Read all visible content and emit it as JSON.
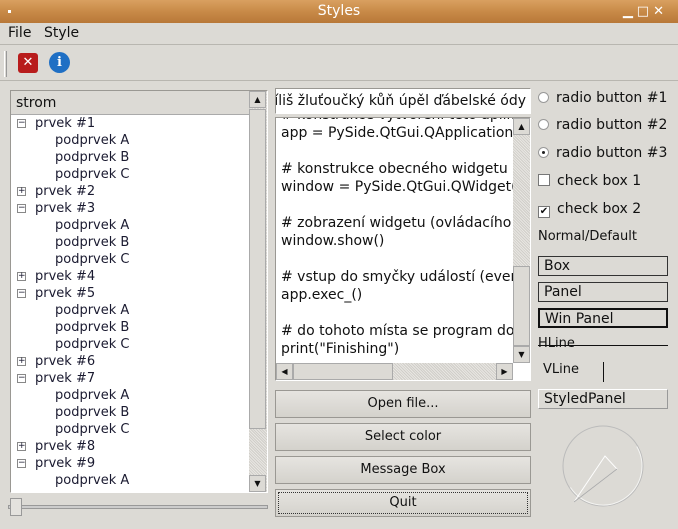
{
  "window": {
    "title": "Styles"
  },
  "menu": [
    "File",
    "Style"
  ],
  "toolbar": {
    "quit_icon": "close-icon",
    "about_icon": "info-icon"
  },
  "tree": {
    "header": "strom",
    "items": [
      {
        "label": "prvek #1",
        "expanded": true,
        "children": [
          "podprvek A",
          "podprvek B",
          "podprvek C"
        ]
      },
      {
        "label": "prvek #2",
        "expanded": false,
        "children": []
      },
      {
        "label": "prvek #3",
        "expanded": true,
        "children": [
          "podprvek A",
          "podprvek B",
          "podprvek C"
        ]
      },
      {
        "label": "prvek #4",
        "expanded": false,
        "children": []
      },
      {
        "label": "prvek #5",
        "expanded": true,
        "children": [
          "podprvek A",
          "podprvek B",
          "podprvek C"
        ]
      },
      {
        "label": "prvek #6",
        "expanded": false,
        "children": []
      },
      {
        "label": "prvek #7",
        "expanded": true,
        "children": [
          "podprvek A",
          "podprvek B",
          "podprvek C"
        ]
      },
      {
        "label": "prvek #8",
        "expanded": false,
        "children": []
      },
      {
        "label": "prvek #9",
        "expanded": true,
        "children": [
          "podprvek A"
        ]
      }
    ]
  },
  "line_edit": {
    "value": "příliš žluťoučký kůň úpěl ďábelské ódy"
  },
  "code_lines": [
    "# konstrukce vytvoření této aplikace",
    "app = PySide.QtGui.QApplication(sys.argv)",
    "",
    "# konstrukce obecného widgetu (okna)",
    "window = PySide.QtGui.QWidget()",
    "",
    "# zobrazení widgetu (ovládacího prvku)",
    "window.show()",
    "",
    "# vstup do smyčky událostí (event loop)",
    "app.exec_()",
    "",
    "# do tohoto místa se program dostane",
    "print(\"Finishing\")"
  ],
  "buttons": {
    "open": "Open file...",
    "color": "Select color",
    "message": "Message Box",
    "quit": "Quit"
  },
  "radios": [
    {
      "label": "radio button #1",
      "checked": false
    },
    {
      "label": "radio button #2",
      "checked": false
    },
    {
      "label": "radio button #3",
      "checked": true
    }
  ],
  "checkboxes": [
    {
      "label": "check box 1",
      "checked": false
    },
    {
      "label": "check box 2",
      "checked": true
    }
  ],
  "frames": {
    "normal": "Normal/Default",
    "box": "Box",
    "panel": "Panel",
    "winpanel": "Win Panel",
    "hline": "HLine",
    "vline": "VLine",
    "styled": "StyledPanel"
  },
  "slider": {
    "value": 0
  },
  "dial": {
    "value_deg": 200
  }
}
